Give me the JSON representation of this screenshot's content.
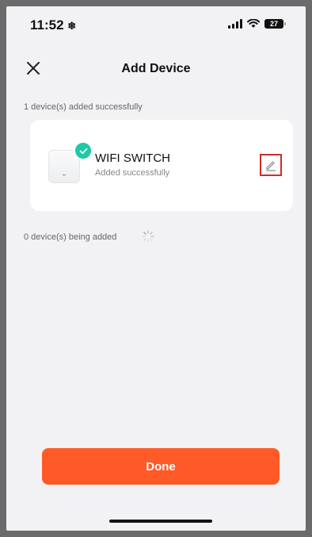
{
  "status_bar": {
    "time": "11:52",
    "battery": "27"
  },
  "header": {
    "title": "Add Device"
  },
  "added_section": {
    "label": "1 device(s) added successfully"
  },
  "device": {
    "name": "WIFI SWITCH",
    "status": "Added successfully"
  },
  "pending_section": {
    "label": "0 device(s) being added"
  },
  "actions": {
    "done_label": "Done"
  },
  "colors": {
    "accent": "#ff5a28",
    "success": "#1ec9a5",
    "highlight": "#d12a2a"
  }
}
